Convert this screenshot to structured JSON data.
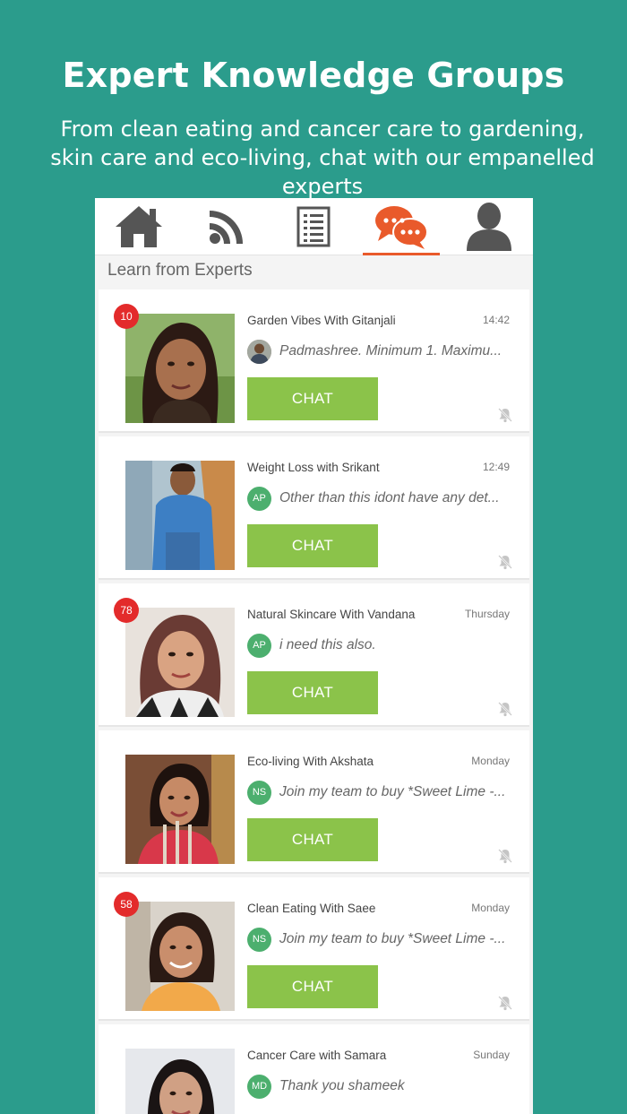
{
  "promo": {
    "headline": "Expert Knowledge Groups",
    "subline": "From clean eating and cancer care to gardening, skin care and eco-living, chat with our empanelled experts"
  },
  "nav": {
    "items": [
      {
        "icon": "home-icon"
      },
      {
        "icon": "feed-icon"
      },
      {
        "icon": "list-icon"
      },
      {
        "icon": "chat-bubbles-icon",
        "active": true
      },
      {
        "icon": "profile-icon"
      }
    ]
  },
  "section": {
    "title": "Learn from Experts"
  },
  "groups": [
    {
      "name": "Garden Vibes With Gitanjali",
      "time": "14:42",
      "badge": "10",
      "avatar": "",
      "message": "Padmashree. Minimum 1. Maximu...",
      "button": "CHAT"
    },
    {
      "name": "Weight Loss with Srikant",
      "time": "12:49",
      "badge": "",
      "avatar": "AP",
      "message": "Other than this idont have any det...",
      "button": "CHAT"
    },
    {
      "name": "Natural Skincare With Vandana",
      "time": "Thursday",
      "badge": "78",
      "avatar": "AP",
      "message": "i need this also.",
      "button": "CHAT"
    },
    {
      "name": "Eco-living With Akshata",
      "time": "Monday",
      "badge": "",
      "avatar": "NS",
      "message": "Join my team to buy *Sweet Lime -...",
      "button": "CHAT"
    },
    {
      "name": "Clean Eating With Saee",
      "time": "Monday",
      "badge": "58",
      "avatar": "NS",
      "message": "Join my team to buy *Sweet Lime -...",
      "button": "CHAT"
    },
    {
      "name": "Cancer Care with Samara",
      "time": "Sunday",
      "badge": "",
      "avatar": "MD",
      "message": "Thank you shameek",
      "button": ""
    }
  ],
  "colors": {
    "background": "#2b9c8c",
    "accent": "#e95a2b",
    "chat_button": "#8bc34a",
    "badge": "#e32b2b",
    "avatar": "#4caf6e"
  }
}
